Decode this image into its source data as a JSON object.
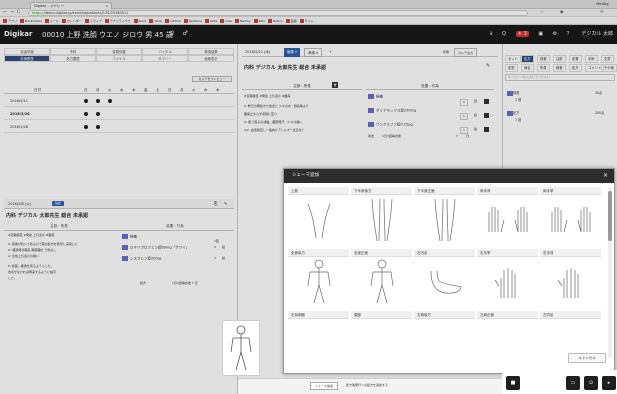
{
  "browser": {
    "tab_title": "Digikar - メドレー",
    "tab_close": "×",
    "profile": "Medley",
    "nav_back": "←",
    "nav_forward": "→",
    "nav_reload": "C",
    "nav_home": "⌂",
    "url_secure": "https://",
    "url_rest": "demo.digikar.jp/karte/id/patients/135/20160511",
    "bookmarks": [
      "アプリ",
      "Bookmarks",
      "メール",
      "カレンダー",
      "ドライブ",
      "アナリティクス",
      "Slack",
      "Trello",
      "GitHub",
      "Redmine",
      "Qiita",
      "note",
      "Medley",
      "Wiki",
      "Notion",
      "製薬",
      "サイト"
    ]
  },
  "app": {
    "logo": "Digikar",
    "patient": "00010 上野 洗顔 ウエノ ジロウ 男 45 歳",
    "header_icons": [
      "♀",
      "♂"
    ],
    "right_labels": [
      "∂",
      "Q",
      "☀ 3",
      "▣",
      "⚙",
      "？",
      "デジカル 太郎"
    ]
  },
  "left": {
    "menu_row1": [
      "患者情報",
      "予約",
      "保険情報",
      "バイタル",
      "検査結果"
    ],
    "menu_row2": [
      "診療履歴",
      "処方履歴",
      "ファイル",
      "サマリー",
      "画像表示"
    ],
    "menu_active": "診療履歴",
    "btn_karte": "カルテをプレビュー",
    "cal_label": "日付",
    "cal_days": [
      "日",
      "月",
      "火",
      "水",
      "木",
      "金",
      "土",
      "日",
      "月",
      "火",
      "水",
      "木"
    ],
    "cal_rows": [
      {
        "date": "2016/5/11",
        "bold": false,
        "dots": 3
      },
      {
        "date": "2016/3/26",
        "bold": true,
        "dots": 2
      },
      {
        "date": "2016/1/28",
        "bold": false,
        "dots": 2
      }
    ],
    "kr_date": "2016/5/8 (火)",
    "kr_badge": "編集",
    "kr_title": "内科 デジカル 太郎先生 総合 未承認",
    "col_left": "主訴・所見",
    "col_right": "処置・行為",
    "sub_lines": [
      "#定期検査 #発熱  上気道炎 #腹痛"
    ],
    "notes": [
      "S: 咳嗽が続いてあるので薬の処方を希望し来院した",
      "O: 咽頭発赤軽度 胸部聴診 ラ音なし",
      "A: 急性上気道炎の疑い",
      "P: 投薬、経過を見るようにした。",
      "    改善がなければ再来するように指示",
      "    した。"
    ],
    "rx_items": [
      "検査",
      "ロキソプロフェン錠60mg「サワイ」",
      "レスプレン錠20mg"
    ],
    "rx_qty": [
      "1回",
      "3",
      "3"
    ],
    "rx_unit": [
      "",
      "錠",
      "錠"
    ],
    "rx_note": "1日3回毎食後 7 日",
    "rx_note2": "処方"
  },
  "middle": {
    "date": "2016/5/11 (水)",
    "tabs": [
      "編集 ▾",
      "承認 ▾",
      "+"
    ],
    "action_tabs": [
      "印刷",
      "カルテ出力"
    ],
    "title": "内科 デジカル 太郎先生 総合 未承認",
    "col_left": "主訴・所見",
    "col_right": "処置・行為",
    "tag_line": "#定期検査 #発熱 上気道炎 #腹痛",
    "notes": [
      "S: 昨日の朝起きた後ほど 少々の水・微熱等より",
      "   腹痛止まらず来院に至り",
      "O: 肌で張るの感触。腹部発汗、少々冷静に",
      "A/P: 血液検査し一般向けアレルギー反応を？"
    ],
    "rx": [
      {
        "name": "検査",
        "qty": "1",
        "unit": "回"
      },
      {
        "name": "ダイアモックス錠250mg",
        "qty": "1",
        "unit": "錠"
      },
      {
        "name": "ワンアルファ錠0.25μg",
        "qty": "1",
        "unit": "錠"
      }
    ],
    "rx_usage": "1日3回毎食後",
    "rx_days": "7",
    "rx_days_unit": "日",
    "rx_label": "用法",
    "bottom_btn1": "シェーマ追加",
    "bottom_text": "処方箋発行への処方を追加する"
  },
  "right": {
    "tabs": [
      "セット",
      "処方",
      "検査",
      "注射",
      "処置",
      "手術",
      "文書"
    ],
    "tabs2": [
      "定型",
      "病名",
      "所見",
      "検査",
      "処方",
      "コメント",
      "その他"
    ],
    "active": "処方",
    "search_placeholder": "キーワードを入力してください",
    "items": [
      {
        "name": "検査",
        "sub": "1 回",
        "val": "30点"
      },
      {
        "name": "処方",
        "sub": "1 回",
        "val": "200点"
      }
    ]
  },
  "modal": {
    "title": "シェーマ追加",
    "close": "×",
    "cancel": "キャンセル",
    "cells": [
      "上肢",
      "下半身後方",
      "下半身正面",
      "両手背",
      "両手掌",
      "全身後方",
      "全身正面",
      "右内足",
      "右手掌",
      "右手背",
      "右耳側面",
      "頭部",
      "左肩後方",
      "左肩正面",
      "左内足"
    ]
  }
}
